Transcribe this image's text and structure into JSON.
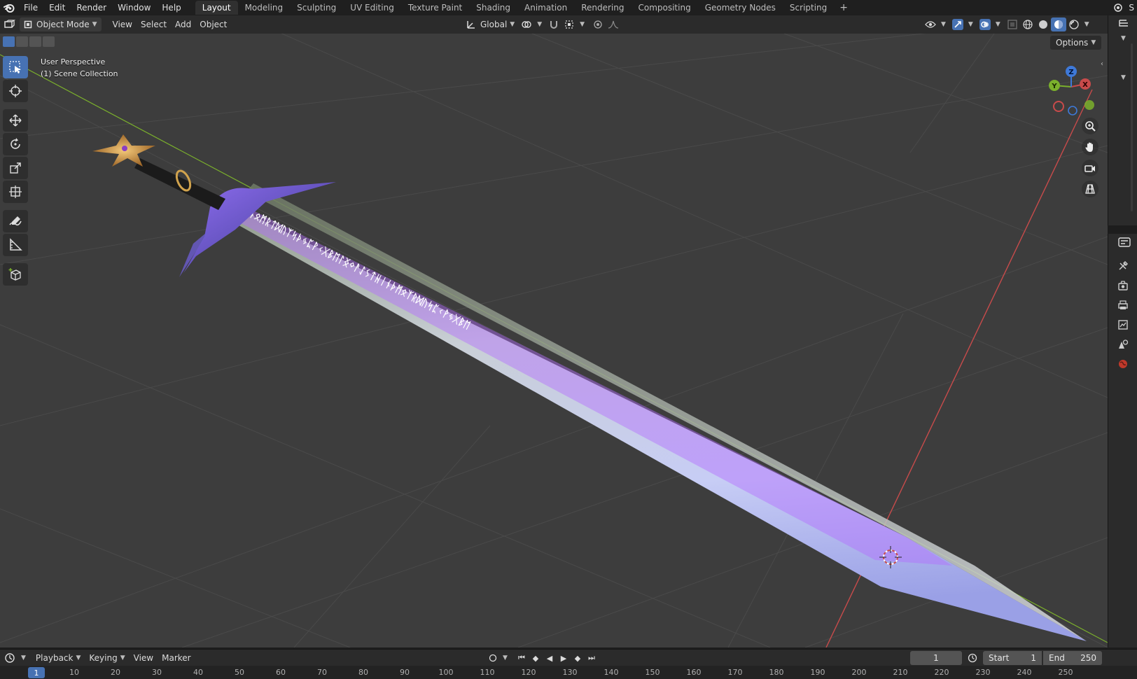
{
  "app": {
    "menus": [
      "File",
      "Edit",
      "Render",
      "Window",
      "Help"
    ],
    "workspaces": [
      "Layout",
      "Modeling",
      "Sculpting",
      "UV Editing",
      "Texture Paint",
      "Shading",
      "Animation",
      "Rendering",
      "Compositing",
      "Geometry Nodes",
      "Scripting"
    ],
    "active_workspace": "Layout",
    "add_workspace_label": "+",
    "scene_label_cut": "S"
  },
  "viewport_header": {
    "mode": "Object Mode",
    "menus": [
      "View",
      "Select",
      "Add",
      "Object"
    ],
    "transform_orientation": "Global",
    "options_label": "Options"
  },
  "viewport": {
    "perspective_label": "User Perspective",
    "collection_label": "(1) Scene Collection",
    "gizmo_axes": {
      "x": "X",
      "y": "Y",
      "z": "Z"
    },
    "runes": "ᚠᛁᚾᛟᛗᚱᛏᛞᚢᛉᛋᚦᛃᛈᚹᚲᚷᛒᛖᛚᛝᛜᚨᛇᛊᛏᚺᛁᚾᚦᛗᛟᛉᚱᛞᚢᛋᛈᚲᚹᛃᚷᛒᛖ"
  },
  "toolbar": {
    "tools": [
      "select-box",
      "cursor",
      "move",
      "rotate",
      "scale",
      "transform",
      "annotate",
      "measure",
      "add-cube"
    ],
    "active_tool": "select-box"
  },
  "timeline": {
    "menus": [
      "Playback",
      "Keying",
      "View",
      "Marker"
    ],
    "current_frame": "1",
    "start_label": "Start",
    "start_value": "1",
    "end_label": "End",
    "end_value": "250",
    "ruler_ticks": [
      "10",
      "20",
      "30",
      "40",
      "50",
      "60",
      "70",
      "80",
      "90",
      "100",
      "110",
      "120",
      "130",
      "140",
      "150",
      "160",
      "170",
      "180",
      "190",
      "200",
      "210",
      "220",
      "230",
      "240",
      "250"
    ],
    "marker_value": "1"
  },
  "colors": {
    "accent": "#4772b3",
    "viewport_bg": "#3d3d3d",
    "axis_x": "#c84b4b",
    "axis_y": "#7bb02c",
    "axis_z": "#3e79d8",
    "rune_glow": "#b36cff"
  }
}
